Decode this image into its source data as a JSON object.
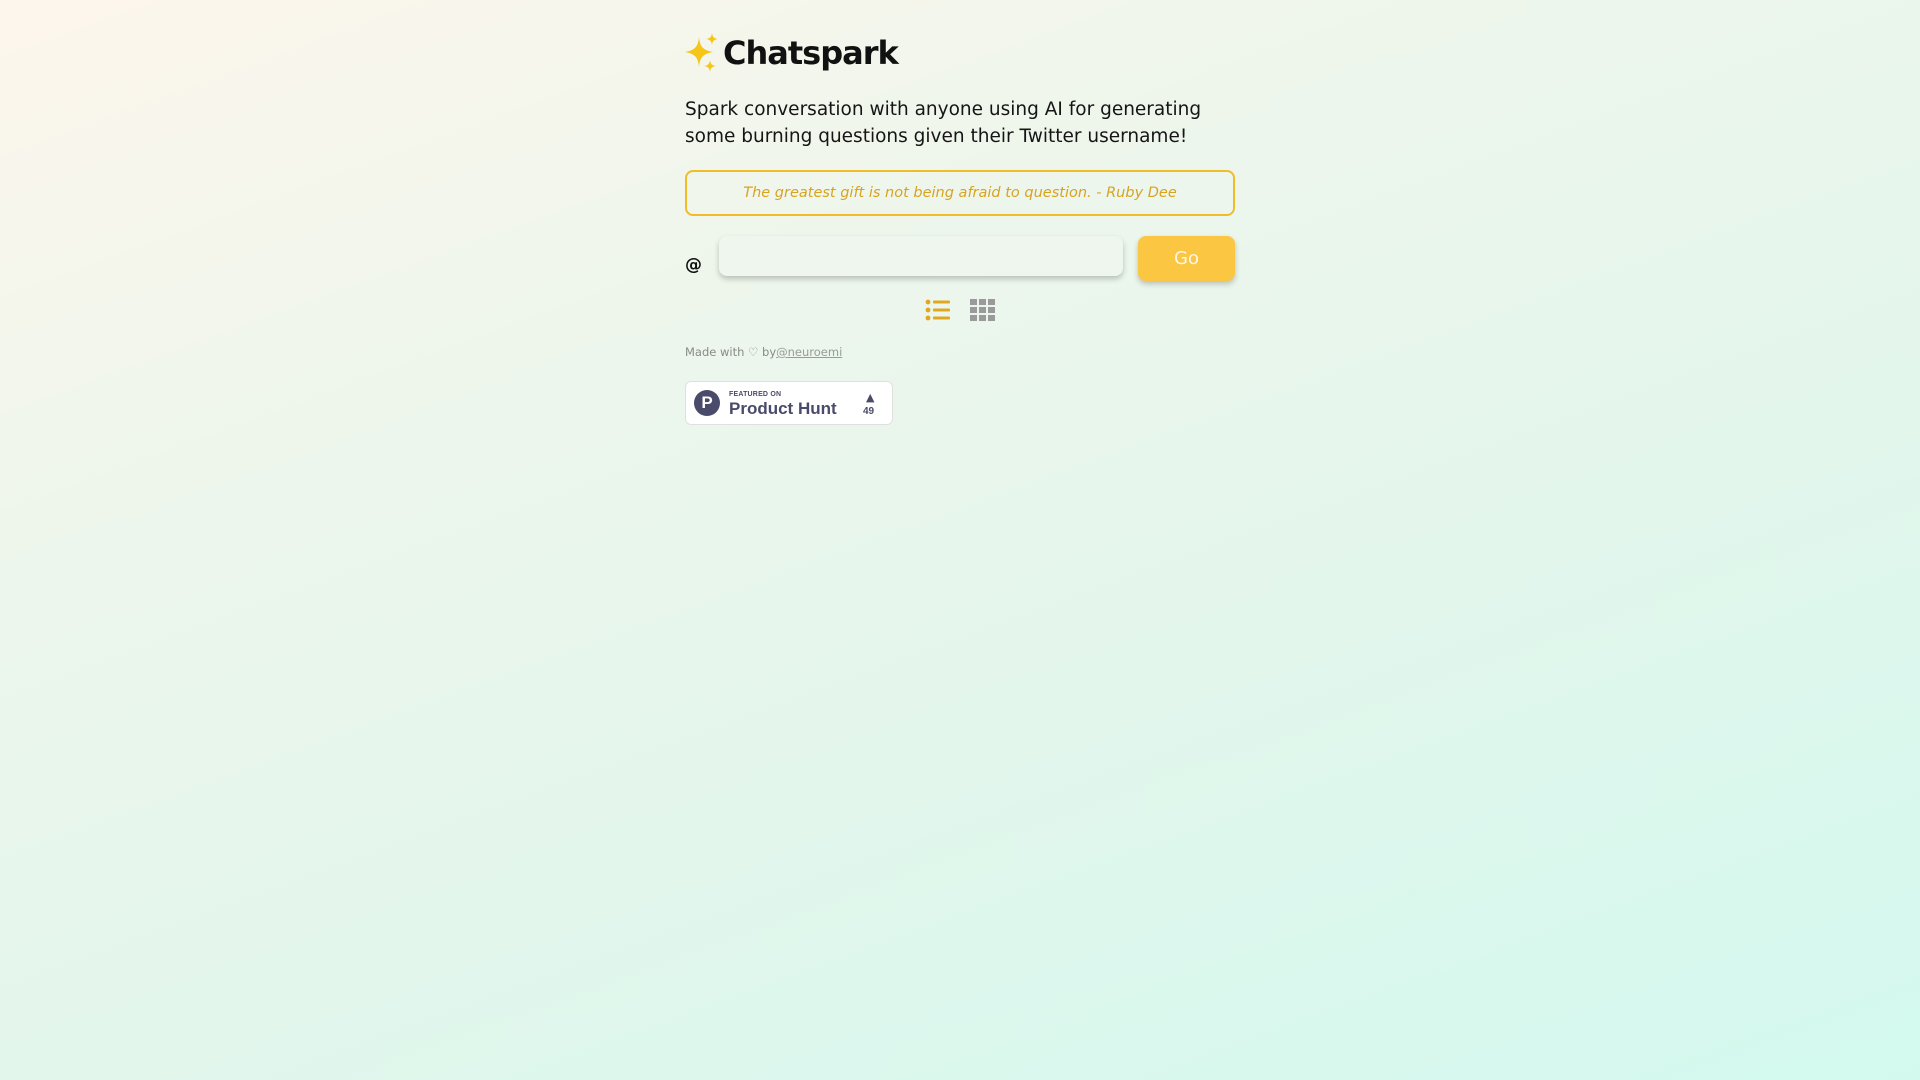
{
  "brand": {
    "title": "Chatspark",
    "icon": "sparkles-icon"
  },
  "tagline": "Spark conversation with anyone using AI for generating some burning questions given their Twitter username!",
  "quote": {
    "text": "The greatest gift is not being afraid to question. - Ruby Dee"
  },
  "search": {
    "prefix": "@",
    "value": "",
    "placeholder": "",
    "button_label": "Go"
  },
  "view_toggle": {
    "options": [
      {
        "icon": "list-icon",
        "active": true
      },
      {
        "icon": "grid-icon",
        "active": false
      }
    ]
  },
  "footer": {
    "made_with": "Made with ♡ by",
    "author_handle": "@neuroemi"
  },
  "product_hunt": {
    "featured_label": "FEATURED ON",
    "name": "Product Hunt",
    "logo_letter": "P",
    "arrow": "▲",
    "upvotes": "49"
  },
  "colors": {
    "accent": "#fbc641",
    "quote_border": "#f1bb2a",
    "quote_text": "#d8a320",
    "active_icon": "#e0a81f",
    "inactive_icon": "#9a9a9a",
    "ph_brand": "#4a4a6a"
  }
}
